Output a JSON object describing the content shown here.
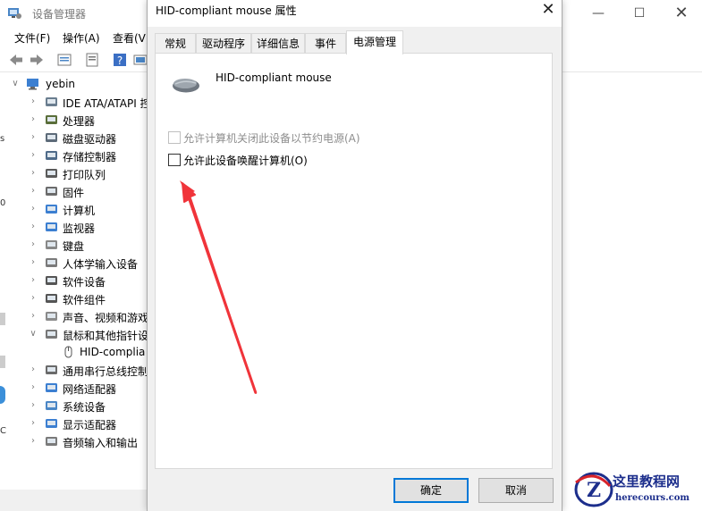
{
  "main_window": {
    "title": "设备管理器",
    "controls": {
      "minimize": "—",
      "maximize": "☐",
      "close": "✕"
    },
    "menu": [
      "文件(F)",
      "操作(A)",
      "查看(V)"
    ],
    "tree": {
      "root": "yebin",
      "items": [
        {
          "label": "IDE ATA/ATAPI 控",
          "icon": "ide-controller-icon"
        },
        {
          "label": "处理器",
          "icon": "processor-icon"
        },
        {
          "label": "磁盘驱动器",
          "icon": "disk-drive-icon"
        },
        {
          "label": "存储控制器",
          "icon": "storage-controller-icon"
        },
        {
          "label": "打印队列",
          "icon": "printer-icon"
        },
        {
          "label": "固件",
          "icon": "firmware-icon"
        },
        {
          "label": "计算机",
          "icon": "computer-icon"
        },
        {
          "label": "监视器",
          "icon": "monitor-icon"
        },
        {
          "label": "键盘",
          "icon": "keyboard-icon"
        },
        {
          "label": "人体学输入设备",
          "icon": "hid-icon"
        },
        {
          "label": "软件设备",
          "icon": "software-device-icon"
        },
        {
          "label": "软件组件",
          "icon": "software-component-icon"
        },
        {
          "label": "声音、视频和游戏",
          "icon": "sound-icon"
        },
        {
          "label": "鼠标和其他指针设",
          "icon": "mouse-category-icon"
        },
        {
          "label": "HID-complia",
          "icon": "mouse-icon"
        },
        {
          "label": "通用串行总线控制",
          "icon": "usb-icon"
        },
        {
          "label": "网络适配器",
          "icon": "network-adapter-icon"
        },
        {
          "label": "系统设备",
          "icon": "system-device-icon"
        },
        {
          "label": "显示适配器",
          "icon": "display-adapter-icon"
        },
        {
          "label": "音频输入和输出",
          "icon": "audio-io-icon"
        }
      ]
    }
  },
  "dialog": {
    "title": "HID-compliant mouse 属性",
    "close": "✕",
    "tabs": [
      "常规",
      "驱动程序",
      "详细信息",
      "事件",
      "电源管理"
    ],
    "active_tab": "电源管理",
    "device_name": "HID-compliant mouse",
    "options": [
      {
        "label": "允许计算机关闭此设备以节约电源(A)",
        "checked": false,
        "enabled": false
      },
      {
        "label": "允许此设备唤醒计算机(O)",
        "checked": false,
        "enabled": true
      }
    ],
    "buttons": {
      "ok": "确定",
      "cancel": "取消"
    }
  },
  "watermark": {
    "main_text": "这里教程网",
    "url": "herecours.com"
  },
  "colors": {
    "accent": "#0078d7",
    "arrow": "#f0343a",
    "watermark": "#1c2e8c"
  }
}
